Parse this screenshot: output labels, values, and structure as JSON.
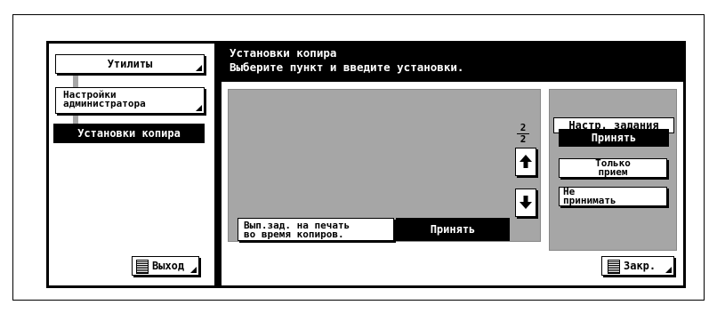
{
  "header": {
    "title": "Установки копира",
    "subtitle": "Выберите пункт и введите установки."
  },
  "sidebar": {
    "items": [
      {
        "label": "Утилиты"
      },
      {
        "label_line1": "Настройки",
        "label_line2": "администратора"
      },
      {
        "label": "Установки копира",
        "selected": true
      }
    ],
    "exit_label": "Выход"
  },
  "main": {
    "page_current": "2",
    "page_total": "2",
    "setting": {
      "name_line1": "Вып.зад. на печать",
      "name_line2": "во время копиров.",
      "value": "Принять"
    },
    "close_label": "Закр."
  },
  "job_settings": {
    "title": "Настр. задания",
    "options": [
      {
        "label": "Принять",
        "selected": true
      },
      {
        "label_line1": "Только",
        "label_line2": "прием"
      },
      {
        "label_line1": "Не",
        "label_line2": "принимать"
      }
    ]
  },
  "icons": [
    "up-arrow-icon",
    "down-arrow-icon",
    "corner-triangle-icon"
  ]
}
